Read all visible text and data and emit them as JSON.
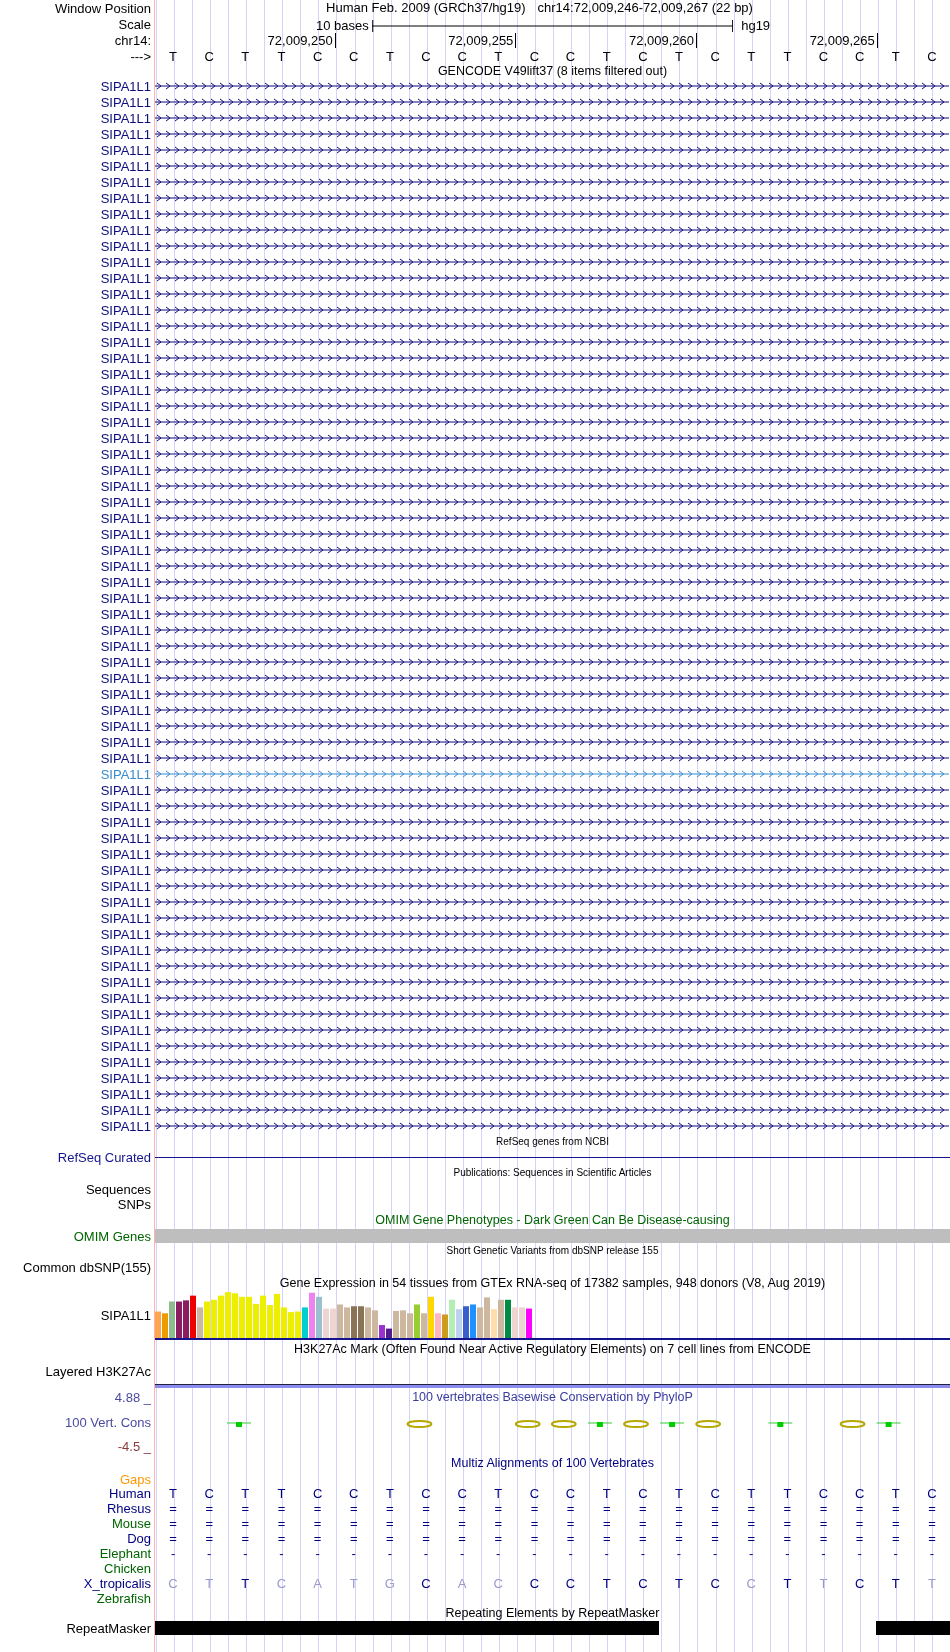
{
  "header": {
    "position_label": "Window Position",
    "assembly": "Human Feb. 2009 (GRCh37/hg19)",
    "position": "chr14:72,009,246-72,009,267 (22 bp)",
    "scale_label": "Scale",
    "scale_text": "10 bases",
    "scale_assembly": "hg19",
    "chrom_label": "chr14:",
    "ruler_ticks": [
      "72,009,250",
      "72,009,255",
      "72,009,260",
      "72,009,265"
    ],
    "strand_label": "--->",
    "bases": [
      "T",
      "C",
      "T",
      "T",
      "C",
      "C",
      "T",
      "C",
      "C",
      "T",
      "C",
      "C",
      "T",
      "C",
      "T",
      "C",
      "T",
      "T",
      "C",
      "C",
      "T",
      "C"
    ]
  },
  "gencode": {
    "title": "GENCODE V49lift37 (8 items filtered out)",
    "genes": [
      {
        "label": "SIPA1L1",
        "selected": false
      },
      {
        "label": "SIPA1L1",
        "selected": false
      },
      {
        "label": "SIPA1L1",
        "selected": false
      },
      {
        "label": "SIPA1L1",
        "selected": false
      },
      {
        "label": "SIPA1L1",
        "selected": false
      },
      {
        "label": "SIPA1L1",
        "selected": false
      },
      {
        "label": "SIPA1L1",
        "selected": false
      },
      {
        "label": "SIPA1L1",
        "selected": false
      },
      {
        "label": "SIPA1L1",
        "selected": false
      },
      {
        "label": "SIPA1L1",
        "selected": false
      },
      {
        "label": "SIPA1L1",
        "selected": false
      },
      {
        "label": "SIPA1L1",
        "selected": false
      },
      {
        "label": "SIPA1L1",
        "selected": false
      },
      {
        "label": "SIPA1L1",
        "selected": false
      },
      {
        "label": "SIPA1L1",
        "selected": false
      },
      {
        "label": "SIPA1L1",
        "selected": false
      },
      {
        "label": "SIPA1L1",
        "selected": false
      },
      {
        "label": "SIPA1L1",
        "selected": false
      },
      {
        "label": "SIPA1L1",
        "selected": false
      },
      {
        "label": "SIPA1L1",
        "selected": false
      },
      {
        "label": "SIPA1L1",
        "selected": false
      },
      {
        "label": "SIPA1L1",
        "selected": false
      },
      {
        "label": "SIPA1L1",
        "selected": false
      },
      {
        "label": "SIPA1L1",
        "selected": false
      },
      {
        "label": "SIPA1L1",
        "selected": false
      },
      {
        "label": "SIPA1L1",
        "selected": false
      },
      {
        "label": "SIPA1L1",
        "selected": false
      },
      {
        "label": "SIPA1L1",
        "selected": false
      },
      {
        "label": "SIPA1L1",
        "selected": false
      },
      {
        "label": "SIPA1L1",
        "selected": false
      },
      {
        "label": "SIPA1L1",
        "selected": false
      },
      {
        "label": "SIPA1L1",
        "selected": false
      },
      {
        "label": "SIPA1L1",
        "selected": false
      },
      {
        "label": "SIPA1L1",
        "selected": false
      },
      {
        "label": "SIPA1L1",
        "selected": false
      },
      {
        "label": "SIPA1L1",
        "selected": false
      },
      {
        "label": "SIPA1L1",
        "selected": false
      },
      {
        "label": "SIPA1L1",
        "selected": false
      },
      {
        "label": "SIPA1L1",
        "selected": false
      },
      {
        "label": "SIPA1L1",
        "selected": false
      },
      {
        "label": "SIPA1L1",
        "selected": false
      },
      {
        "label": "SIPA1L1",
        "selected": false
      },
      {
        "label": "SIPA1L1",
        "selected": false
      },
      {
        "label": "SIPA1L1",
        "selected": true
      },
      {
        "label": "SIPA1L1",
        "selected": false
      },
      {
        "label": "SIPA1L1",
        "selected": false
      },
      {
        "label": "SIPA1L1",
        "selected": false
      },
      {
        "label": "SIPA1L1",
        "selected": false
      },
      {
        "label": "SIPA1L1",
        "selected": false
      },
      {
        "label": "SIPA1L1",
        "selected": false
      },
      {
        "label": "SIPA1L1",
        "selected": false
      },
      {
        "label": "SIPA1L1",
        "selected": false
      },
      {
        "label": "SIPA1L1",
        "selected": false
      },
      {
        "label": "SIPA1L1",
        "selected": false
      },
      {
        "label": "SIPA1L1",
        "selected": false
      },
      {
        "label": "SIPA1L1",
        "selected": false
      },
      {
        "label": "SIPA1L1",
        "selected": false
      },
      {
        "label": "SIPA1L1",
        "selected": false
      },
      {
        "label": "SIPA1L1",
        "selected": false
      },
      {
        "label": "SIPA1L1",
        "selected": false
      },
      {
        "label": "SIPA1L1",
        "selected": false
      },
      {
        "label": "SIPA1L1",
        "selected": false
      },
      {
        "label": "SIPA1L1",
        "selected": false
      },
      {
        "label": "SIPA1L1",
        "selected": false
      },
      {
        "label": "SIPA1L1",
        "selected": false
      },
      {
        "label": "SIPA1L1",
        "selected": false
      }
    ]
  },
  "refseq": {
    "title": "RefSeq genes from NCBI",
    "label": "RefSeq Curated"
  },
  "publications": {
    "title": "Publications: Sequences in Scientific Articles",
    "labels": [
      "Sequences",
      "SNPs"
    ]
  },
  "omim": {
    "title": "OMIM Gene Phenotypes - Dark Green Can Be Disease-causing",
    "label": "OMIM Genes"
  },
  "dbsnp": {
    "title": "Short Genetic Variants from dbSNP release 155",
    "label": "Common dbSNP(155)"
  },
  "gtex": {
    "title": "Gene Expression in 54 tissues from GTEx RNA-seq of 17382 samples, 948 donors (V8, Aug 2019)",
    "label": "SIPA1L1"
  },
  "h3k27ac": {
    "title": "H3K27Ac Mark (Often Found Near Active Regulatory Elements) on 7 cell lines from ENCODE",
    "label": "Layered H3K27Ac"
  },
  "phylop": {
    "title": "100 vertebrates Basewise Conservation by PhyloP",
    "label": "100 Vert. Cons",
    "y_max": "4.88 _",
    "y_min": "-4.5 _"
  },
  "multiz": {
    "title": "Multiz Alignments of 100 Vertebrates",
    "gaps_label": "Gaps",
    "species": [
      {
        "name": "Human",
        "color": "#000080",
        "bases": [
          "T",
          "C",
          "T",
          "T",
          "C",
          "C",
          "T",
          "C",
          "C",
          "T",
          "C",
          "C",
          "T",
          "C",
          "T",
          "C",
          "T",
          "T",
          "C",
          "C",
          "T",
          "C"
        ]
      },
      {
        "name": "Rhesus",
        "color": "#000080",
        "bases": [
          "=",
          "=",
          "=",
          "=",
          "=",
          "=",
          "=",
          "=",
          "=",
          "=",
          "=",
          "=",
          "=",
          "=",
          "=",
          "=",
          "=",
          "=",
          "=",
          "=",
          "=",
          "="
        ]
      },
      {
        "name": "Mouse",
        "color": "#006400",
        "bases": [
          "=",
          "=",
          "=",
          "=",
          "=",
          "=",
          "=",
          "=",
          "=",
          "=",
          "=",
          "=",
          "=",
          "=",
          "=",
          "=",
          "=",
          "=",
          "=",
          "=",
          "=",
          "="
        ]
      },
      {
        "name": "Dog",
        "color": "#000080",
        "bases": [
          "=",
          "=",
          "=",
          "=",
          "=",
          "=",
          "=",
          "=",
          "=",
          "=",
          "=",
          "=",
          "=",
          "=",
          "=",
          "=",
          "=",
          "=",
          "=",
          "=",
          "=",
          "="
        ]
      },
      {
        "name": "Elephant",
        "color": "#006400",
        "bases": [
          "-",
          "-",
          "-",
          "-",
          "-",
          "-",
          "-",
          "-",
          "-",
          "-",
          "-",
          "-",
          "-",
          "-",
          "-",
          "-",
          "-",
          "-",
          "-",
          "-",
          "-",
          "-"
        ]
      },
      {
        "name": "Chicken",
        "color": "#006400"
      },
      {
        "name": "X_tropicalis",
        "color": "#000080",
        "bases": [
          "C",
          "T",
          "T",
          "C",
          "A",
          "T",
          "G",
          "C",
          "A",
          "C",
          "C",
          "C",
          "T",
          "C",
          "T",
          "C",
          "C",
          "T",
          "T",
          "C",
          "T",
          "T"
        ],
        "matches": [
          false,
          false,
          true,
          false,
          false,
          false,
          false,
          true,
          false,
          false,
          true,
          true,
          true,
          true,
          true,
          true,
          false,
          true,
          false,
          true,
          true,
          false
        ]
      },
      {
        "name": "Zebrafish",
        "color": "#006400"
      }
    ]
  },
  "repeatmasker": {
    "title": "Repeating Elements by RepeatMasker",
    "label": "RepeatMasker"
  }
}
